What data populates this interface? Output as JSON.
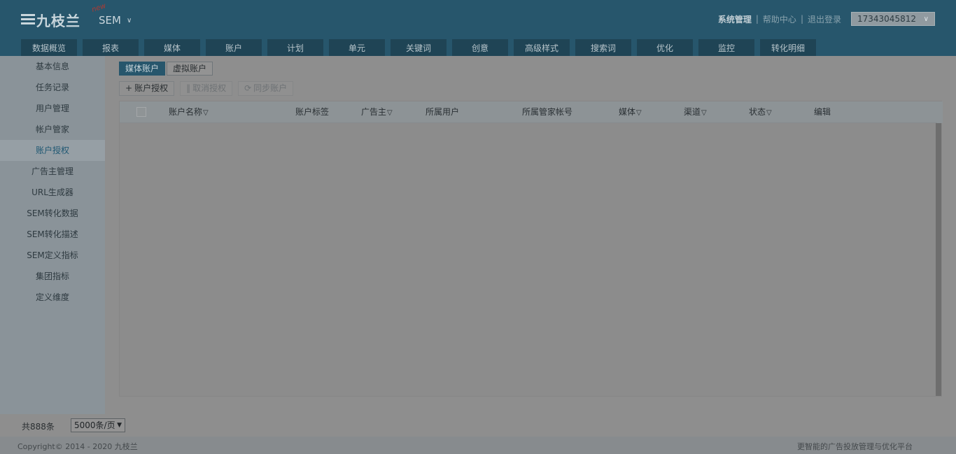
{
  "header": {
    "logo_text": "九枝兰",
    "new_tag": "new",
    "product": "SEM",
    "links": [
      {
        "label": "系统管理"
      },
      {
        "label": "帮助中心"
      },
      {
        "label": "退出登录"
      }
    ],
    "separator": "|",
    "account": "17343045812"
  },
  "nav": [
    {
      "label": "数据概览"
    },
    {
      "label": "报表"
    },
    {
      "label": "媒体"
    },
    {
      "label": "账户"
    },
    {
      "label": "计划"
    },
    {
      "label": "单元"
    },
    {
      "label": "关键词"
    },
    {
      "label": "创意"
    },
    {
      "label": "高级样式"
    },
    {
      "label": "搜索词"
    },
    {
      "label": "优化"
    },
    {
      "label": "监控"
    },
    {
      "label": "转化明细"
    }
  ],
  "sidebar": {
    "items": [
      {
        "label": "基本信息"
      },
      {
        "label": "任务记录"
      },
      {
        "label": "用户管理"
      },
      {
        "label": "帐户管家"
      },
      {
        "label": "账户授权"
      },
      {
        "label": "广告主管理"
      },
      {
        "label": "URL生成器"
      },
      {
        "label": "SEM转化数据"
      },
      {
        "label": "SEM转化描述"
      },
      {
        "label": "SEM定义指标"
      },
      {
        "label": "集团指标"
      },
      {
        "label": "定义维度"
      }
    ],
    "active_index": 4
  },
  "subtabs": [
    {
      "label": "媒体账户"
    },
    {
      "label": "虚拟账户"
    }
  ],
  "toolbar": {
    "authorize": "账户授权",
    "cancel": "取消授权",
    "sync": "同步账户"
  },
  "table": {
    "columns": [
      "账户名称",
      "账户标签",
      "广告主",
      "所属用户",
      "所属管家帐号",
      "媒体",
      "渠道",
      "状态",
      "编辑"
    ],
    "rows": []
  },
  "pager": {
    "total": "共888条",
    "page_size": "5000条/页"
  },
  "footer": {
    "copyright": "Copyright© 2014 - 2020 九枝兰",
    "slogan": "更智能的广告投放管理与优化平台"
  }
}
